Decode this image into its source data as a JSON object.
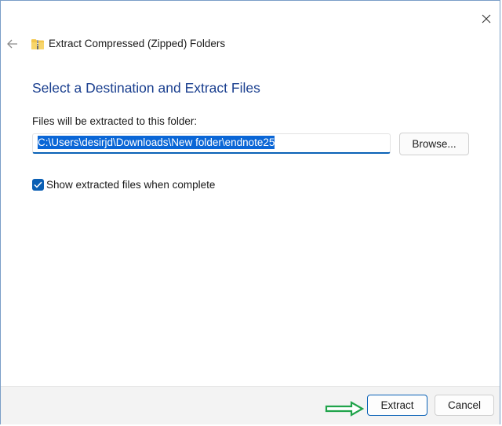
{
  "window": {
    "title": "Extract Compressed (Zipped) Folders",
    "title_icon": "zipped-folder-icon",
    "back_icon": "back-arrow-icon",
    "close_icon": "close-icon"
  },
  "main": {
    "heading": "Select a Destination and Extract Files",
    "destination_label": "Files will be extracted to this folder:",
    "destination_value": "C:\\Users\\desirjd\\Downloads\\New folder\\endnote25",
    "browse_label": "Browse...",
    "show_files_checked": true,
    "show_files_label": "Show extracted files when complete"
  },
  "footer": {
    "extract_label": "Extract",
    "cancel_label": "Cancel",
    "annotation_icon": "green-arrow-icon"
  },
  "colors": {
    "heading": "#1a3f8f",
    "accent": "#0a62b7",
    "selection": "#0a66d6",
    "annotation_arrow": "#1fa34a"
  }
}
